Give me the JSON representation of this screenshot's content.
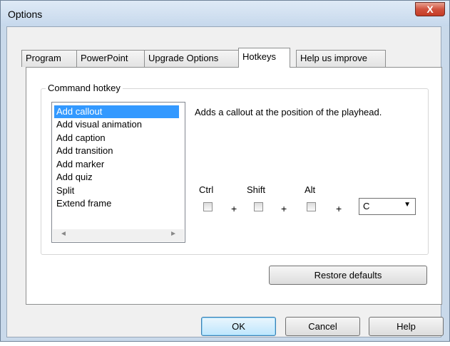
{
  "window": {
    "title": "Options",
    "close_glyph": "X"
  },
  "tabs": [
    {
      "label": "Program"
    },
    {
      "label": "PowerPoint"
    },
    {
      "label": "Upgrade Options"
    },
    {
      "label": "Hotkeys"
    },
    {
      "label": "Help us improve"
    }
  ],
  "active_tab": "Hotkeys",
  "group": {
    "label": "Command hotkey"
  },
  "commands": [
    "Add callout",
    "Add visual animation",
    "Add caption",
    "Add transition",
    "Add marker",
    "Add quiz",
    "Split",
    "Extend frame"
  ],
  "selected_command": "Add callout",
  "description": "Adds a callout at the position of the playhead.",
  "modifiers": {
    "ctrl": "Ctrl",
    "shift": "Shift",
    "alt": "Alt",
    "plus": "+"
  },
  "key_select": {
    "value": "C",
    "arrow": "▼"
  },
  "buttons": {
    "restore": "Restore defaults",
    "ok": "OK",
    "cancel": "Cancel",
    "help": "Help"
  },
  "scroll": {
    "left": "◄",
    "right": "►"
  },
  "colors": {
    "selection": "#3399ff",
    "close_button": "#c53b25"
  }
}
